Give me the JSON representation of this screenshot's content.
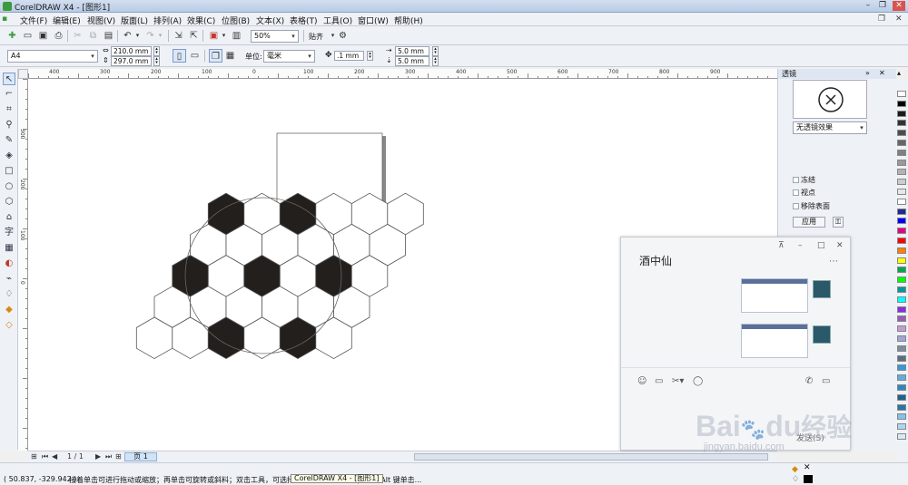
{
  "window": {
    "title": "CorelDRAW X4 - [图形1]"
  },
  "menu": [
    "文件(F)",
    "编辑(E)",
    "视图(V)",
    "版面(L)",
    "排列(A)",
    "效果(C)",
    "位图(B)",
    "文本(X)",
    "表格(T)",
    "工具(O)",
    "窗口(W)",
    "帮助(H)"
  ],
  "toolbar": {
    "zoom": "50%",
    "snap_label": "贴齐"
  },
  "propbar": {
    "page_size": "A4",
    "width": "210.0 mm",
    "height": "297.0 mm",
    "units_label": "单位:",
    "units": "毫米",
    "nudge": ".1 mm",
    "dup_x": "5.0 mm",
    "dup_y": "5.0 mm"
  },
  "ruler": {
    "h_labels": [
      "400",
      "300",
      "200",
      "100",
      "0",
      "100",
      "200",
      "300",
      "400",
      "500",
      "600",
      "700",
      "800",
      "900"
    ],
    "v_labels": [
      "300",
      "200",
      "100",
      "0"
    ]
  },
  "docker": {
    "title": "透镜",
    "effect": "无透镜效果",
    "options": [
      "冻结",
      "视点",
      "移除表面"
    ],
    "apply": "应用"
  },
  "chat": {
    "name": "酒中仙",
    "send": "发送(S)"
  },
  "pagebar": {
    "page_count": "1 / 1",
    "page_tab": "页 1"
  },
  "status": {
    "coords": "( 50.837, -329.942 )",
    "hint": "接着单击可进行拖动或缩放；再单击可旋转或斜料；双击工具，可选择所有 ... 择多个对象；按住 Alt 键单击...",
    "tooltip": "CorelDRAW X4 - [图形1]"
  },
  "watermark": {
    "brand": "Bai",
    "brand2": "du",
    "cn": "经验",
    "url": "jingyan.baidu.com"
  },
  "palette_colors": [
    "#ffffff",
    "#000000",
    "#1a1a1a",
    "#333333",
    "#4d4d4d",
    "#666666",
    "#808080",
    "#999999",
    "#b3b3b3",
    "#cccccc",
    "#e6e6e6",
    "#ffffff",
    "#1e2b8f",
    "#0000ff",
    "#e6007e",
    "#ff0000",
    "#ff8000",
    "#ffff00",
    "#00a651",
    "#00ff00",
    "#009999",
    "#00ffff",
    "#8a2be2",
    "#9b59b6",
    "#c39bd3",
    "#a3a3d6",
    "#7f8c9d",
    "#5d6d7e",
    "#3498db",
    "#5dade2",
    "#2e86c1",
    "#1f618d",
    "#2874a6",
    "#85c1e9",
    "#aed6f1",
    "#d6eaf8"
  ],
  "hexagons": [
    [
      0,
      0,
      1
    ],
    [
      1,
      0,
      0
    ],
    [
      2,
      0,
      1
    ],
    [
      3,
      0,
      0
    ],
    [
      4,
      0,
      0
    ],
    [
      5,
      0,
      0
    ],
    [
      -0.5,
      1,
      0
    ],
    [
      0.5,
      1,
      0
    ],
    [
      1.5,
      1,
      0
    ],
    [
      2.5,
      1,
      0
    ],
    [
      3.5,
      1,
      0
    ],
    [
      4.5,
      1,
      0
    ],
    [
      -1,
      2,
      1
    ],
    [
      0,
      2,
      0
    ],
    [
      1,
      2,
      1
    ],
    [
      2,
      2,
      0
    ],
    [
      3,
      2,
      1
    ],
    [
      4,
      2,
      0
    ],
    [
      -1.5,
      3,
      0
    ],
    [
      -0.5,
      3,
      0
    ],
    [
      0.5,
      3,
      0
    ],
    [
      1.5,
      3,
      0
    ],
    [
      2.5,
      3,
      0
    ],
    [
      3.5,
      3,
      0
    ],
    [
      -2,
      4,
      0
    ],
    [
      -1,
      4,
      0
    ],
    [
      0,
      4,
      1
    ],
    [
      1,
      4,
      0
    ],
    [
      2,
      4,
      1
    ],
    [
      3,
      4,
      0
    ]
  ]
}
